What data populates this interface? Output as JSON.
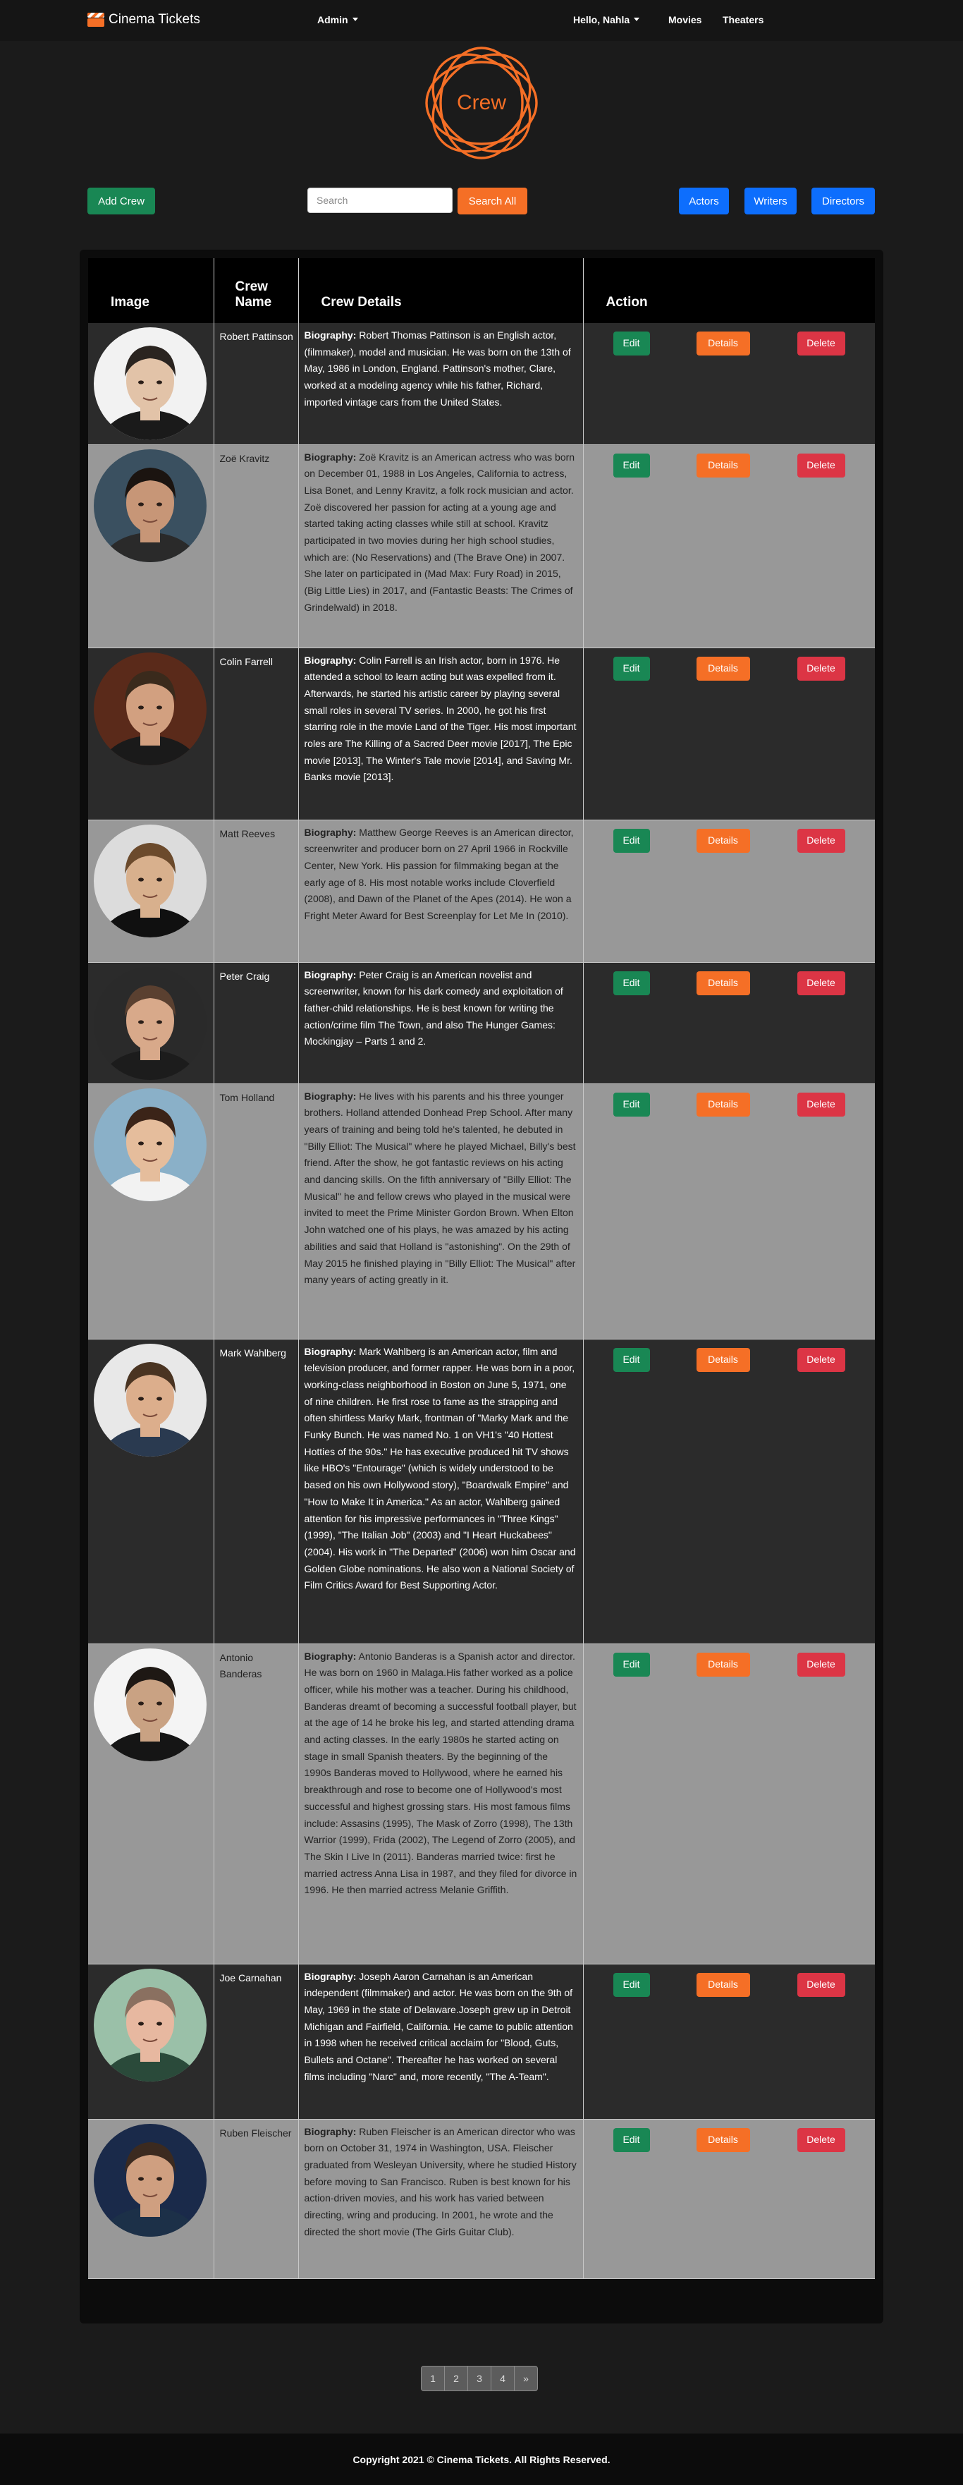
{
  "nav": {
    "brand": "Cinema Tickets",
    "admin": "Admin",
    "user": "Hello, Nahla",
    "movies": "Movies",
    "theaters": "Theaters"
  },
  "logo": {
    "text": "Crew"
  },
  "toolbar": {
    "add": "Add Crew",
    "search_placeholder": "Search",
    "search_all": "Search All",
    "actors": "Actors",
    "writers": "Writers",
    "directors": "Directors"
  },
  "table": {
    "headers": [
      "Image",
      "Crew Name",
      "Crew Details",
      "Action"
    ],
    "bio_label": "Biography:",
    "edit": "Edit",
    "details": "Details",
    "delete": "Delete",
    "rows": [
      {
        "name": "Robert Pattinson",
        "bio": "Robert Thomas Pattinson is an English actor, (filmmaker), model and musician. He was born on the 13th of May, 1986 in London, England. Pattinson's mother, Clare, worked at a modeling agency while his father, Richard, imported vintage cars from the United States."
      },
      {
        "name": "Zoë Kravitz",
        "bio": "Zoë Kravitz is an American actress who was born on December 01, 1988 in Los Angeles, California to actress, Lisa Bonet, and Lenny Kravitz, a folk rock musician and actor. Zoë discovered her passion for acting at a young age and started taking acting classes while still at school. Kravitz participated in two movies during her high school studies, which are: (No Reservations) and (The Brave One) in 2007. She later on participated in (Mad Max: Fury Road) in 2015, (Big Little Lies) in 2017, and (Fantastic Beasts: The Crimes of Grindelwald) in 2018."
      },
      {
        "name": "Colin Farrell",
        "bio": "Colin Farrell is an Irish actor, born in 1976. He attended a school to learn acting but was expelled from it. Afterwards, he started his artistic career by playing several small roles in several TV series. In 2000, he got his first starring role in the movie Land of the Tiger. His most important roles are The Killing of a Sacred Deer movie [2017], The Epic movie [2013], The Winter's Tale movie [2014], and Saving Mr. Banks movie [2013]."
      },
      {
        "name": "Matt Reeves",
        "bio": "Matthew George Reeves is an American director, screenwriter and producer born on 27 April 1966 in Rockville Center, New York. His passion for filmmaking began at the early age of 8. His most notable works include Cloverfield (2008), and Dawn of the Planet of the Apes (2014). He won a Fright Meter Award for Best Screenplay for Let Me In (2010)."
      },
      {
        "name": "Peter Craig",
        "bio": "Peter Craig is an American novelist and screenwriter, known for his dark comedy and exploitation of father-child relationships. He is best known for writing the action/crime film The Town, and also The Hunger Games: Mockingjay – Parts 1 and 2."
      },
      {
        "name": "Tom Holland",
        "bio": "He lives with his parents and his three younger brothers. Holland attended Donhead Prep School. After many years of training and being told he's talented, he debuted in \"Billy Elliot: The Musical\" where he played Michael, Billy's best friend. After the show, he got fantastic reviews on his acting and dancing skills. On the fifth anniversary of \"Billy Elliot: The Musical\" he and fellow crews who played in the musical were invited to meet the Prime Minister Gordon Brown. When Elton John watched one of his plays, he was amazed by his acting abilities and said that Holland is \"astonishing\". On the 29th of May 2015 he finished playing in \"Billy Elliot: The Musical\" after many years of acting greatly in it."
      },
      {
        "name": "Mark Wahlberg",
        "bio": "Mark Wahlberg is an American actor, film and television producer, and former rapper. He was born in a poor, working-class neighborhood in Boston on June 5, 1971, one of nine children. He first rose to fame as the strapping and often shirtless Marky Mark, frontman of \"Marky Mark and the Funky Bunch. He was named No. 1 on VH1's \"40 Hottest Hotties of the 90s.\" He has executive produced hit TV shows like HBO's \"Entourage\" (which is widely understood to be based on his own Hollywood story), \"Boardwalk Empire\" and \"How to Make It in America.\" As an actor, Wahlberg gained attention for his impressive performances in \"Three Kings\" (1999), \"The Italian Job\" (2003) and \"I Heart Huckabees\" (2004). His work in \"The Departed\" (2006) won him Oscar and Golden Globe nominations. He also won a National Society of Film Critics Award for Best Supporting Actor."
      },
      {
        "name": "Antonio Banderas",
        "bio": "Antonio Banderas is a Spanish actor and director. He was born on 1960 in Malaga.His father worked as a police officer, while his mother was a teacher. During his childhood, Banderas dreamt of becoming a successful football player, but at the age of 14 he broke his leg, and started attending drama and acting classes. In the early 1980s he started acting on stage in small Spanish theaters. By the beginning of the 1990s Banderas moved to Hollywood, where he earned his breakthrough and rose to become one of Hollywood's most successful and highest grossing stars. His most famous films include: Assasins (1995), The Mask of Zorro (1998), The 13th Warrior (1999), Frida (2002), The Legend of Zorro (2005), and The Skin I Live In (2011). Banderas married twice: first he married actress Anna Lisa in 1987, and they filed for divorce in 1996. He then married actress Melanie Griffith."
      },
      {
        "name": "Joe Carnahan",
        "bio": "Joseph Aaron Carnahan is an American independent (filmmaker) and actor. He was born on the 9th of May, 1969 in the state of Delaware.Joseph grew up in Detroit Michigan and Fairfield, California. He came to public attention in 1998 when he received critical acclaim for \"Blood, Guts, Bullets and Octane\". Thereafter he has worked on several films including \"Narc\" and, more recently, \"The A-Team\"."
      },
      {
        "name": "Ruben Fleischer",
        "bio": "Ruben Fleischer is an American director who was born on October 31, 1974 in Washington, USA. Fleischer graduated from Wesleyan University, where he studied History before moving to San Francisco. Ruben is best known for his action-driven movies, and his work has varied between directing, wring and producing. In 2001, he wrote and the directed the short movie (The Girls Guitar Club)."
      }
    ]
  },
  "pagination": [
    "1",
    "2",
    "3",
    "4",
    "»"
  ],
  "footer": "Copyright 2021 © Cinema Tickets. All Rights Reserved.",
  "colors": {
    "accent": "#f56f26",
    "add_button": "#198754",
    "filter_buttons": "#0d6efd",
    "delete_button": "#dc3545",
    "page_bg": "#1b1b1b"
  },
  "icons": {
    "brand": "clapperboard-icon",
    "dropdown": "caret-down-icon"
  }
}
